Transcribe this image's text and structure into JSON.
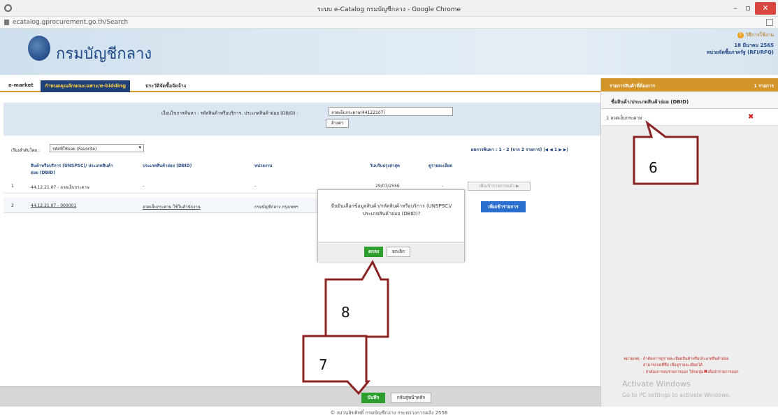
{
  "browser": {
    "title": "ระบบ e-Catalog กรมบัญชีกลาง - Google Chrome",
    "url": "ecatalog.gprocurement.go.th/Search",
    "min": "–",
    "max": "▫",
    "close": "✕"
  },
  "header": {
    "logo_text": "กรมบัญชีกลาง",
    "help": "วิธีการใช้งาน",
    "date": "18 มีนาคม 2565",
    "unit": "หน่วยจัดซื้อภาครัฐ (RFI/RFQ)"
  },
  "nav": {
    "items": [
      "e-market",
      "กำหนดคุณลักษณะเฉพาะ/e-bidding",
      "ประวัติจัดซื้อจัดจ้าง"
    ]
  },
  "search": {
    "label": "เงื่อนไขการค้นหา : รหัสสินค้าหรือบริการ, ประเภทสินค้าย่อย (DBID) :",
    "value": "ลวดเย็บกระดาษ(44122107)",
    "clear": "ล้างค่า"
  },
  "sort": {
    "label": "เรียงลำดับโดย :",
    "selected": "รหัสที่ใช้บ่อย (Favorite)"
  },
  "results": "ผลการค้นหา : 1 - 2 (จาก 2 รายการ)",
  "table": {
    "headers": [
      "สินค้าหรือบริการ (UNSPSC)/ ประเภทสินค้าย่อย (DBID)",
      "ประเภทสินค้าย่อย (DBID)",
      "หน่วยงาน",
      "วันปรับปรุงล่าสุด",
      "ดูรายละเอียด"
    ],
    "rows": [
      {
        "no": "1",
        "code": "44.12.21.07 - ลวดเย็บกระดาษ",
        "dbid": "-",
        "agency": "-",
        "updated": "29/07/2556",
        "detail": "-",
        "action": "เพิ่มเข้ารายการแล้ว ▶"
      },
      {
        "no": "2",
        "code": "44.12.21.07 - 000001",
        "dbid": "ลวดเย็บกระดาษ ใช้ในสำนักงาน",
        "agency": "กรมบัญชีกลาง กรุงเทพฯ",
        "updated": "",
        "detail": "",
        "action": "เพิ่มเข้ารายการ"
      }
    ]
  },
  "dialog": {
    "message": "ยืนยันเลือกข้อมูลสินค้า/รหัสสินค้าหรือบริการ (UNSPSC)/ประเภทสินค้าย่อย (DBID)?",
    "ok": "ตกลง",
    "cancel": "ยกเลิก"
  },
  "right_panel": {
    "title": "รายการสินค้าที่ต้องการ",
    "count": "1 รายการ",
    "subtitle": "ชื่อสินค้า/ประเภทสินค้าย่อย (DBID)",
    "item": "1  ลวดเย็บกระดาษ",
    "note_1": "หมายเหตุ : ถ้าต้องการดูรายละเอียดสินค้าหรือประเภทสินค้าย่อย",
    "note_2": "สามารถกดที่ชื่อ เพื่อดูรายละเอียดได้",
    "note_3": ": ถ้าต้องการลบรายการออก ให้กดปุ่ม",
    "note_4": "เพื่อนำรายการออก",
    "activate_1": "Activate Windows",
    "activate_2": "Go to PC settings to activate Windows."
  },
  "bottom": {
    "save": "บันทึก",
    "back": "กลับสู่หน้าหลัก",
    "footer": "© สงวนลิขสิทธิ์ กรมบัญชีกลาง กระทรวงการคลัง 2556"
  },
  "callouts": {
    "c6": "6",
    "c7": "7",
    "c8": "8"
  },
  "colors": {
    "nav_active": "#1f3f77",
    "panel_header": "#d4962a",
    "callout_border": "#8b2323",
    "ok_green": "#2e9e2e"
  }
}
